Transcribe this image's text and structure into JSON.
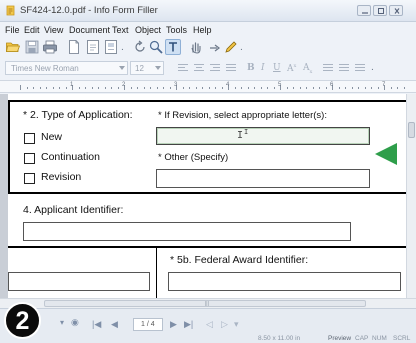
{
  "window": {
    "title": "SF424-12.0.pdf - Info Form Filler"
  },
  "menu": {
    "items": [
      "File",
      "Edit",
      "View",
      "Document",
      "Text",
      "Object",
      "Tools",
      "Help"
    ]
  },
  "format_toolbar": {
    "font_name": "Times New Roman",
    "font_size": "12"
  },
  "ruler": {
    "numbers": [
      "1",
      "2",
      "3",
      "4",
      "5",
      "6",
      "7"
    ]
  },
  "form": {
    "type_of_application": {
      "label": "* 2. Type of Application:",
      "options": [
        "New",
        "Continuation",
        "Revision"
      ]
    },
    "revision_letters_label": "* If Revision, select appropriate letter(s):",
    "revision_letters_value": "I",
    "other_specify_label": "* Other (Specify)",
    "applicant_identifier_label": "4. Applicant Identifier:",
    "federal_award_identifier_label": "* 5b. Federal Award Identifier:"
  },
  "status_bar": {
    "page_indicator": "1 / 4",
    "page_size": "8.50 x 11.00 in",
    "mode": "Preview",
    "indicators": [
      "CAP",
      "NUM",
      "SCRL"
    ]
  },
  "overlay": {
    "step_number": "2",
    "arrow_color": "#2e9e4a"
  }
}
